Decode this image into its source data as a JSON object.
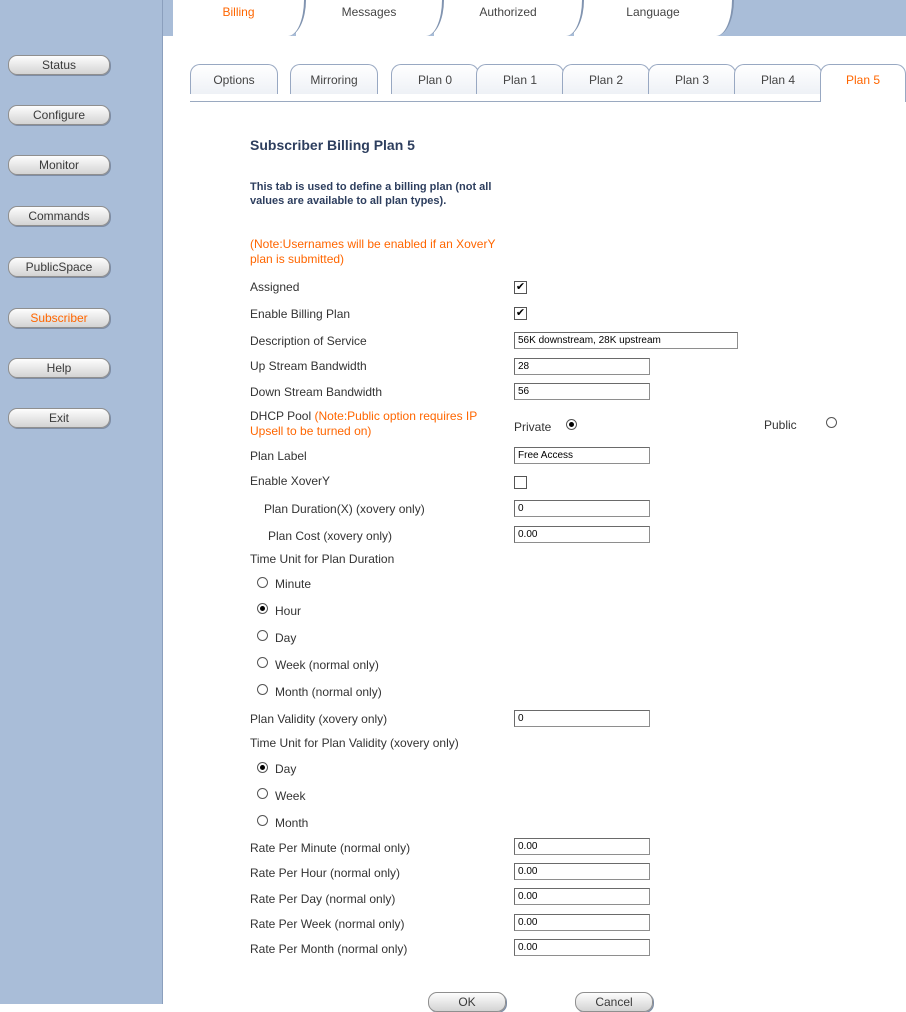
{
  "sidebar": {
    "items": [
      {
        "label": "Status"
      },
      {
        "label": "Configure"
      },
      {
        "label": "Monitor"
      },
      {
        "label": "Commands"
      },
      {
        "label": "PublicSpace"
      },
      {
        "label": "Subscriber",
        "active": true
      },
      {
        "label": "Help"
      },
      {
        "label": "Exit"
      }
    ]
  },
  "top_tabs": [
    {
      "label": "Billing",
      "active": true
    },
    {
      "label": "Messages"
    },
    {
      "label": "Authorized"
    },
    {
      "label": "Language"
    }
  ],
  "sub_tabs": [
    {
      "label": "Options"
    },
    {
      "label": "Mirroring"
    },
    {
      "label": "Plan 0"
    },
    {
      "label": "Plan 1"
    },
    {
      "label": "Plan 2"
    },
    {
      "label": "Plan 3"
    },
    {
      "label": "Plan 4"
    },
    {
      "label": "Plan 5",
      "active": true
    }
  ],
  "page": {
    "title": "Subscriber Billing Plan 5",
    "description": "This tab is used to define a billing plan (not all values are available to all plan types).",
    "note": "(Note:Usernames will be enabled if an XoverY plan is submitted)"
  },
  "form": {
    "assigned": {
      "label": "Assigned",
      "checked": true,
      "mark": "✔"
    },
    "enable_billing": {
      "label": "Enable Billing Plan",
      "checked": true,
      "mark": "✔"
    },
    "description_service": {
      "label": "Description of Service",
      "value": "56K downstream, 28K upstream"
    },
    "up_bandwidth": {
      "label": "Up Stream Bandwidth",
      "value": "28"
    },
    "down_bandwidth": {
      "label": "Down Stream Bandwidth",
      "value": "56"
    },
    "dhcp_pool": {
      "label": "DHCP Pool",
      "note": "(Note:Public option requires IP Upsell to be turned on)",
      "private_label": "Private",
      "public_label": "Public",
      "selected": "Private"
    },
    "plan_label": {
      "label": "Plan Label",
      "value": "Free Access"
    },
    "enable_xovery": {
      "label": "Enable XoverY",
      "checked": false
    },
    "plan_duration": {
      "label": "Plan Duration(X) (xovery only)",
      "value": "0"
    },
    "plan_cost": {
      "label": "Plan Cost (xovery only)",
      "value": "0.00"
    },
    "time_unit_duration": {
      "label": "Time Unit for Plan Duration",
      "options": [
        "Minute",
        "Hour",
        "Day",
        "Week (normal only)",
        "Month (normal only)"
      ],
      "selected": "Hour"
    },
    "plan_validity": {
      "label": "Plan Validity (xovery only)",
      "value": "0"
    },
    "time_unit_validity": {
      "label": "Time Unit for Plan Validity (xovery only)",
      "options": [
        "Day",
        "Week",
        "Month"
      ],
      "selected": "Day"
    },
    "rate_minute": {
      "label": "Rate Per Minute (normal only)",
      "value": "0.00"
    },
    "rate_hour": {
      "label": "Rate Per Hour (normal only)",
      "value": "0.00"
    },
    "rate_day": {
      "label": "Rate Per Day (normal only)",
      "value": "0.00"
    },
    "rate_week": {
      "label": "Rate Per Week (normal only)",
      "value": "0.00"
    },
    "rate_month": {
      "label": "Rate Per Month (normal only)",
      "value": "0.00"
    }
  },
  "buttons": {
    "ok": "OK",
    "cancel": "Cancel"
  },
  "colors": {
    "sidebar_bg": "#a9bdd8",
    "active_text": "#ff6600",
    "heading": "#2d3e5e"
  }
}
